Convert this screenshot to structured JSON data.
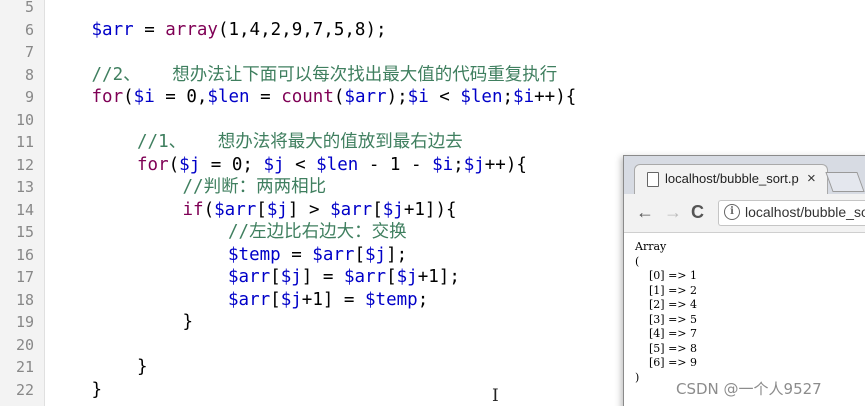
{
  "editor": {
    "lines": [
      {
        "num": "5",
        "indent": 0,
        "tokens": []
      },
      {
        "num": "6",
        "indent": 1,
        "tokens": [
          {
            "t": "v",
            "s": "$arr"
          },
          {
            "t": "p",
            "s": " = "
          },
          {
            "t": "k",
            "s": "array"
          },
          {
            "t": "p",
            "s": "(1,4,2,9,7,5,8);"
          }
        ]
      },
      {
        "num": "7",
        "indent": 0,
        "tokens": []
      },
      {
        "num": "8",
        "indent": 1,
        "tokens": [
          {
            "t": "c",
            "s": "//2、   想办法让下面可以每次找出最大值的代码重复执行"
          }
        ]
      },
      {
        "num": "9",
        "indent": 1,
        "tokens": [
          {
            "t": "k",
            "s": "for"
          },
          {
            "t": "p",
            "s": "("
          },
          {
            "t": "v",
            "s": "$i"
          },
          {
            "t": "p",
            "s": " = 0,"
          },
          {
            "t": "v",
            "s": "$len"
          },
          {
            "t": "p",
            "s": " = "
          },
          {
            "t": "k",
            "s": "count"
          },
          {
            "t": "p",
            "s": "("
          },
          {
            "t": "v",
            "s": "$arr"
          },
          {
            "t": "p",
            "s": ");"
          },
          {
            "t": "v",
            "s": "$i"
          },
          {
            "t": "p",
            "s": " < "
          },
          {
            "t": "v",
            "s": "$len"
          },
          {
            "t": "p",
            "s": ";"
          },
          {
            "t": "v",
            "s": "$i"
          },
          {
            "t": "p",
            "s": "++){"
          }
        ]
      },
      {
        "num": "10",
        "indent": 0,
        "tokens": []
      },
      {
        "num": "11",
        "indent": 2,
        "tokens": [
          {
            "t": "c",
            "s": "//1、   想办法将最大的值放到最右边去"
          }
        ]
      },
      {
        "num": "12",
        "indent": 2,
        "tokens": [
          {
            "t": "k",
            "s": "for"
          },
          {
            "t": "p",
            "s": "("
          },
          {
            "t": "v",
            "s": "$j"
          },
          {
            "t": "p",
            "s": " = 0; "
          },
          {
            "t": "v",
            "s": "$j"
          },
          {
            "t": "p",
            "s": " < "
          },
          {
            "t": "v",
            "s": "$len"
          },
          {
            "t": "p",
            "s": " - 1 - "
          },
          {
            "t": "v",
            "s": "$i"
          },
          {
            "t": "p",
            "s": ";"
          },
          {
            "t": "v",
            "s": "$j"
          },
          {
            "t": "p",
            "s": "++){"
          }
        ]
      },
      {
        "num": "13",
        "indent": 3,
        "tokens": [
          {
            "t": "c",
            "s": "//判断：两两相比"
          }
        ]
      },
      {
        "num": "14",
        "indent": 3,
        "tokens": [
          {
            "t": "k",
            "s": "if"
          },
          {
            "t": "p",
            "s": "("
          },
          {
            "t": "v",
            "s": "$arr"
          },
          {
            "t": "p",
            "s": "["
          },
          {
            "t": "v",
            "s": "$j"
          },
          {
            "t": "p",
            "s": "] > "
          },
          {
            "t": "v",
            "s": "$arr"
          },
          {
            "t": "p",
            "s": "["
          },
          {
            "t": "v",
            "s": "$j"
          },
          {
            "t": "p",
            "s": "+1]){"
          }
        ]
      },
      {
        "num": "15",
        "indent": 4,
        "tokens": [
          {
            "t": "c",
            "s": "//左边比右边大：交换"
          }
        ]
      },
      {
        "num": "16",
        "indent": 4,
        "tokens": [
          {
            "t": "v",
            "s": "$temp"
          },
          {
            "t": "p",
            "s": " = "
          },
          {
            "t": "v",
            "s": "$arr"
          },
          {
            "t": "p",
            "s": "["
          },
          {
            "t": "v",
            "s": "$j"
          },
          {
            "t": "p",
            "s": "];"
          }
        ]
      },
      {
        "num": "17",
        "indent": 4,
        "tokens": [
          {
            "t": "v",
            "s": "$arr"
          },
          {
            "t": "p",
            "s": "["
          },
          {
            "t": "v",
            "s": "$j"
          },
          {
            "t": "p",
            "s": "] = "
          },
          {
            "t": "v",
            "s": "$arr"
          },
          {
            "t": "p",
            "s": "["
          },
          {
            "t": "v",
            "s": "$j"
          },
          {
            "t": "p",
            "s": "+1];"
          }
        ]
      },
      {
        "num": "18",
        "indent": 4,
        "tokens": [
          {
            "t": "v",
            "s": "$arr"
          },
          {
            "t": "p",
            "s": "["
          },
          {
            "t": "v",
            "s": "$j"
          },
          {
            "t": "p",
            "s": "+1] = "
          },
          {
            "t": "v",
            "s": "$temp"
          },
          {
            "t": "p",
            "s": ";"
          }
        ]
      },
      {
        "num": "19",
        "indent": 3,
        "tokens": [
          {
            "t": "p",
            "s": "}"
          }
        ]
      },
      {
        "num": "20",
        "indent": 0,
        "tokens": []
      },
      {
        "num": "21",
        "indent": 2,
        "tokens": [
          {
            "t": "p",
            "s": "}"
          }
        ]
      },
      {
        "num": "22",
        "indent": 1,
        "tokens": [
          {
            "t": "p",
            "s": "}"
          }
        ]
      }
    ]
  },
  "browser": {
    "tab_title": "localhost/bubble_sort.p",
    "tab_close": "×",
    "back": "←",
    "forward": "→",
    "reload": "C",
    "info_glyph": "i",
    "url": "localhost/bubble_sort.php",
    "output": "Array\n(\n    [0] => 1\n    [1] => 2\n    [2] => 4\n    [3] => 5\n    [4] => 7\n    [5] => 8\n    [6] => 9\n)"
  },
  "watermark": "CSDN @一个人9527",
  "cursor_glyph": "I",
  "colors": {
    "variable": "#0000c8",
    "keyword": "#7f0055",
    "comment": "#3f7f5f"
  }
}
